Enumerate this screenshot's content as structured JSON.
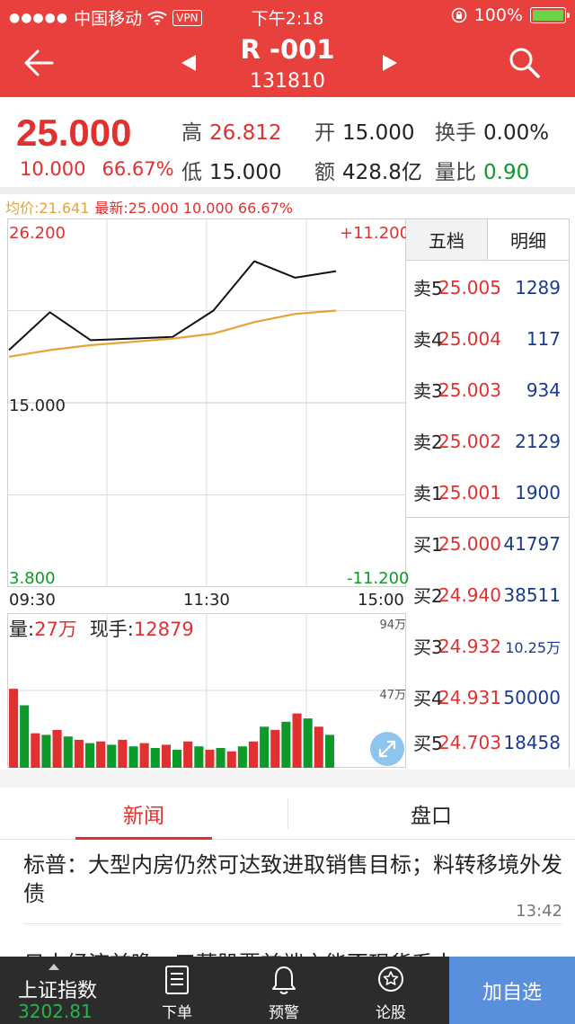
{
  "status_bar": {
    "signal_dots": "●●●●●",
    "carrier": "中国移动",
    "vpn": "VPN",
    "time": "下午2:18",
    "battery": "100%"
  },
  "header": {
    "title": "R -001",
    "code": "131810"
  },
  "quote": {
    "price": "25.000",
    "change": "10.000",
    "change_pct": "66.67%",
    "high_label": "高",
    "high": "26.812",
    "low_label": "低",
    "low": "15.000",
    "open_label": "开",
    "open": "15.000",
    "amount_label": "额",
    "amount": "428.8亿",
    "turnover_label": "换手",
    "turnover": "0.00%",
    "volume_ratio_label": "量比",
    "volume_ratio": "0.90"
  },
  "chart_meta": {
    "avg_label": "均价:21.641",
    "latest": "最新:25.000 10.000 66.67%",
    "y_top": "26.200",
    "y_mid": "15.000",
    "y_bottom": "3.800",
    "pct_top": "+11.200",
    "pct_bottom": "-11.200",
    "x_start": "09:30",
    "x_mid": "11:30",
    "x_end": "15:00",
    "vol_label": "量:",
    "vol_value": "27万",
    "cur_hand_label": "现手:",
    "cur_hand_value": "12879",
    "vol_scale_top": "94万",
    "vol_scale_mid": "47万"
  },
  "chart_data": {
    "type": "line",
    "x": [
      "09:30",
      "10:00",
      "10:30",
      "11:00",
      "11:30",
      "13:30",
      "14:00",
      "14:30",
      "15:00"
    ],
    "ylim": [
      3.8,
      26.2
    ],
    "series": [
      {
        "values": [
          18.2,
          20.5,
          18.8,
          18.9,
          19.0,
          20.6,
          23.6,
          22.6,
          23.0
        ]
      },
      {
        "values": [
          17.8,
          18.2,
          18.5,
          18.7,
          18.9,
          19.2,
          19.9,
          20.4,
          20.6
        ]
      }
    ],
    "volume": {
      "ylim": [
        0,
        940000
      ],
      "values": [
        480000,
        380000,
        210000,
        200000,
        230000,
        190000,
        170000,
        150000,
        160000,
        140000,
        170000,
        130000,
        150000,
        120000,
        140000,
        110000,
        160000,
        130000,
        110000,
        120000,
        100000,
        130000,
        160000,
        250000,
        230000,
        280000,
        330000,
        300000,
        250000,
        200000
      ]
    }
  },
  "order_book": {
    "tabs": [
      "五档",
      "明细"
    ],
    "asks": [
      {
        "label": "卖5",
        "price": "25.005",
        "vol": "1289"
      },
      {
        "label": "卖4",
        "price": "25.004",
        "vol": "117"
      },
      {
        "label": "卖3",
        "price": "25.003",
        "vol": "934"
      },
      {
        "label": "卖2",
        "price": "25.002",
        "vol": "2129"
      },
      {
        "label": "卖1",
        "price": "25.001",
        "vol": "1900"
      }
    ],
    "bids": [
      {
        "label": "买1",
        "price": "25.000",
        "vol": "41797"
      },
      {
        "label": "买2",
        "price": "24.940",
        "vol": "38511"
      },
      {
        "label": "买3",
        "price": "24.932",
        "vol": "10.25万"
      },
      {
        "label": "买4",
        "price": "24.931",
        "vol": "50000"
      },
      {
        "label": "买5",
        "price": "24.703",
        "vol": "18458"
      }
    ]
  },
  "news_tabs": [
    "新闻",
    "盘口"
  ],
  "news": {
    "headline": "标普：大型内房仍然可达致进取销售目标；料转移境外发债",
    "time": "13:42",
    "peek": "日本经济前瞻：三菱股票前端之能否现货系本"
  },
  "bottom_nav": {
    "index_name": "上证指数",
    "index_value": "3202.81",
    "items": [
      {
        "label": "下单",
        "icon": "order-document-icon"
      },
      {
        "label": "预警",
        "icon": "alert-bell-icon"
      },
      {
        "label": "论股",
        "icon": "discussion-star-icon"
      }
    ],
    "add_label": "加自选"
  },
  "colors": {
    "brand": "#e8403c",
    "up": "#e03030",
    "down": "#0e9a2a",
    "avg_line": "#e7a23a",
    "add_button": "#5a8fdc"
  }
}
